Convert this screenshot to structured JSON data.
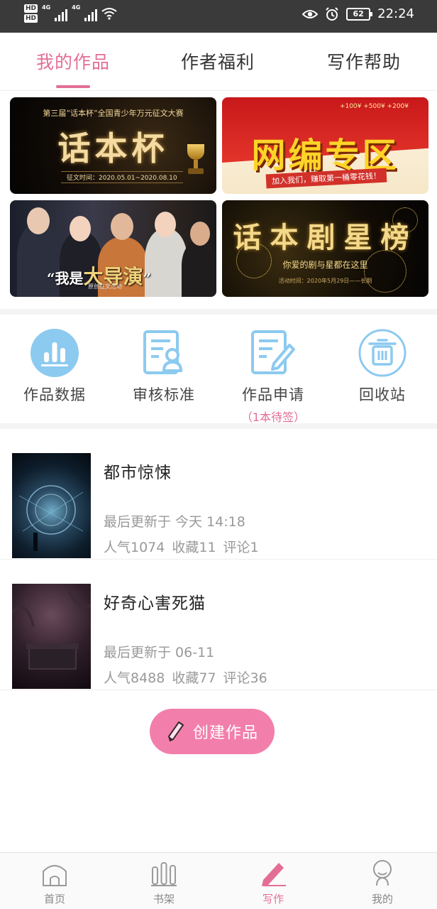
{
  "status_bar": {
    "hd_1": "HD",
    "hd_2": "HD",
    "network_1": "4G",
    "network_2": "4G",
    "battery": "62",
    "time": "22:24"
  },
  "tabs": [
    {
      "label": "我的作品",
      "active": true
    },
    {
      "label": "作者福利",
      "active": false
    },
    {
      "label": "写作帮助",
      "active": false
    }
  ],
  "banners": {
    "b1": {
      "top": "第三届“话本杯”全国青少年万元征文大赛",
      "title": "话本杯",
      "date": "征文时间：2020.05.01~2020.08.10"
    },
    "b2": {
      "coins": "+100¥  +500¥  +200¥",
      "title": "网编专区",
      "sub": "加入我们，赚取第一桶零花钱！"
    },
    "b3": {
      "slogan_pre": "“我是",
      "slogan_main": "大导演",
      "slogan_post": "”",
      "sub": "原创征文活动"
    },
    "b4": {
      "title": "话本剧星榜",
      "sub": "你爱的剧与星都在这里",
      "date": "活动时间：2020年5月29日——长期"
    }
  },
  "actions": [
    {
      "label": "作品数据",
      "icon": "bar-chart-icon"
    },
    {
      "label": "审核标准",
      "icon": "review-standard-icon"
    },
    {
      "label": "作品申请",
      "icon": "edit-document-icon",
      "sub": "（1本待签）"
    },
    {
      "label": "回收站",
      "icon": "trash-icon"
    }
  ],
  "works": [
    {
      "title": "都市惊悚",
      "updated": "最后更新于 今天 14:18",
      "popularity": "人气1074",
      "favorites": "收藏11",
      "comments": "评论1"
    },
    {
      "title": "好奇心害死猫",
      "updated": "最后更新于 06-11",
      "popularity": "人气8488",
      "favorites": "收藏77",
      "comments": "评论36"
    }
  ],
  "create_button": {
    "label": "创建作品"
  },
  "bottom_nav": [
    {
      "label": "首页",
      "icon": "home-icon"
    },
    {
      "label": "书架",
      "icon": "bookshelf-icon"
    },
    {
      "label": "写作",
      "icon": "pen-icon",
      "active": true
    },
    {
      "label": "我的",
      "icon": "profile-icon"
    }
  ],
  "colors": {
    "accent": "#e36e95",
    "create_button": "#f27fab",
    "icon_blue": "#8ccaf0",
    "status_bar": "#3a3a3a"
  }
}
